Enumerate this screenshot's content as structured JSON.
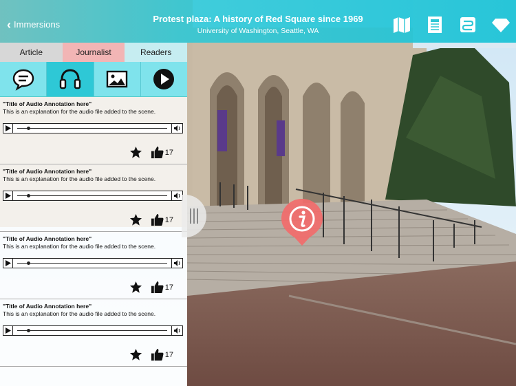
{
  "header": {
    "back_label": "Immersions",
    "title": "Protest plaza: A history of Red Square since 1969",
    "subtitle": "University of Washington, Seattle, WA",
    "icons": [
      "map-icon",
      "article-icon",
      "route-icon",
      "gem-icon"
    ]
  },
  "tabs": [
    {
      "label": "Article"
    },
    {
      "label": "Journalist"
    },
    {
      "label": "Readers"
    }
  ],
  "media_buttons": [
    "chat-bubble-icon",
    "headphones-icon",
    "image-icon",
    "play-circle-icon"
  ],
  "annotations": [
    {
      "title": "\"Title of Audio Annotation here\"",
      "desc": "This is an explanation for the audio file added to the scene.",
      "likes": "17"
    },
    {
      "title": "\"Title of Audio Annotation here\"",
      "desc": "This is an explanation for the audio file added to the scene.",
      "likes": "17"
    },
    {
      "title": "\"Title of Audio Annotation here\"",
      "desc": "This is an explanation for the audio file added to the scene.",
      "likes": "17"
    },
    {
      "title": "\"Title of Audio Annotation here\"",
      "desc": "This is an explanation for the audio file added to the scene.",
      "likes": "17"
    }
  ],
  "colors": {
    "accent": "#2ec8d6",
    "active_tab": "#f2b5b5",
    "hotspot": "#f26b6b"
  }
}
